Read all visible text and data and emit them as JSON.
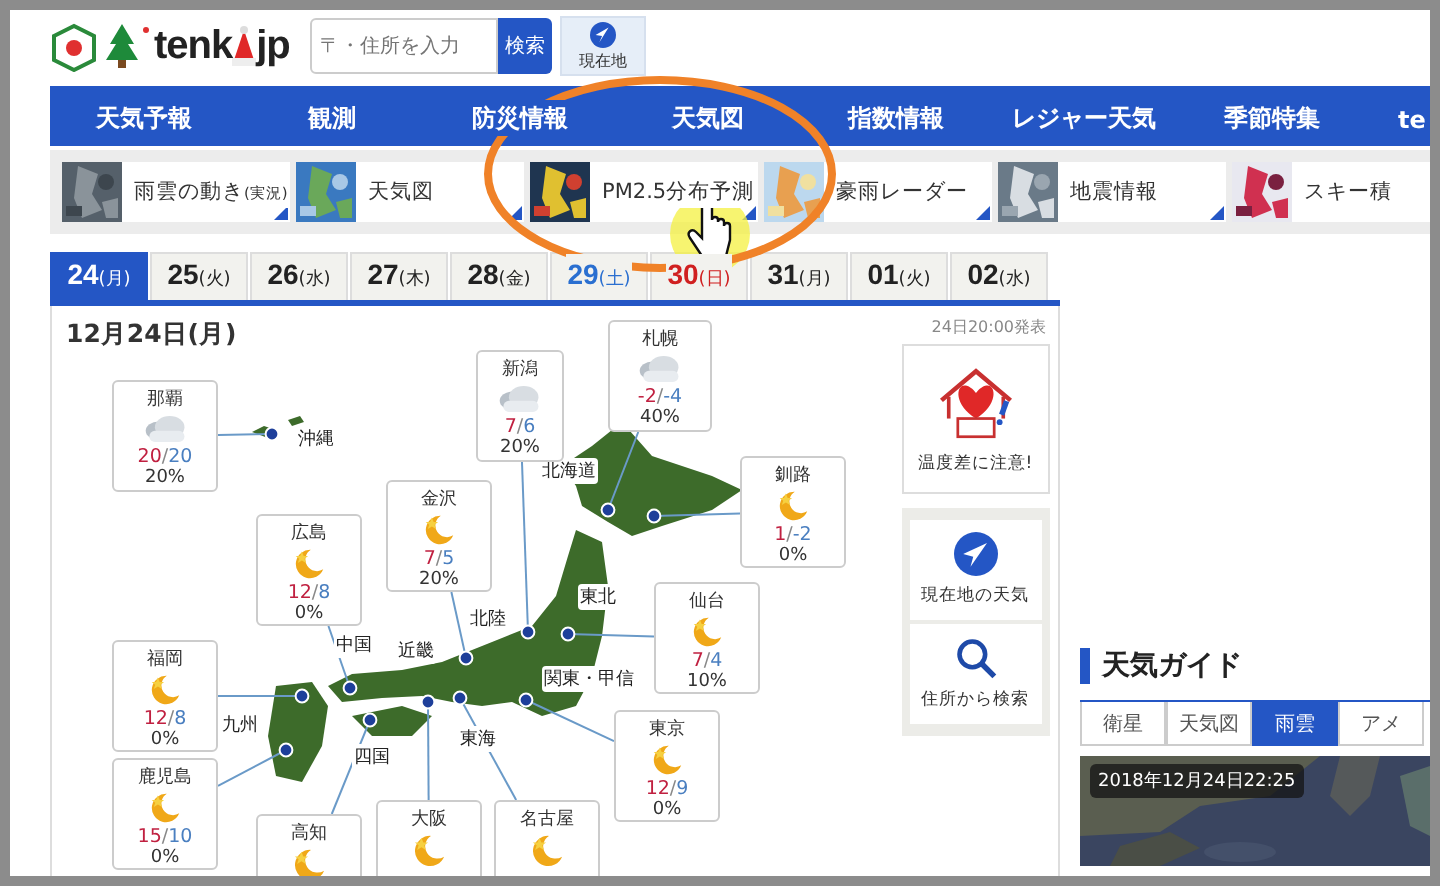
{
  "header": {
    "logo_left": "tenk",
    "logo_right": "jp",
    "search": {
      "placeholder": "〒・住所を入力"
    },
    "search_button": "検索",
    "location_button": "現在地"
  },
  "nav": [
    "天気予報",
    "観測",
    "防災情報",
    "天気図",
    "指数情報",
    "レジャー天気",
    "季節特集",
    "te"
  ],
  "shortcuts": [
    {
      "label": "雨雲の動き",
      "note": "(実況)"
    },
    {
      "label": "天気図"
    },
    {
      "label": "PM2.5分布予測"
    },
    {
      "label": "豪雨レーダー"
    },
    {
      "label": "地震情報"
    },
    {
      "label": "スキー積"
    }
  ],
  "date_tabs": [
    {
      "day": "24",
      "weekday": "(月)",
      "selected": true,
      "kind": "weekday"
    },
    {
      "day": "25",
      "weekday": "(火)",
      "selected": false,
      "kind": "weekday"
    },
    {
      "day": "26",
      "weekday": "(水)",
      "selected": false,
      "kind": "weekday"
    },
    {
      "day": "27",
      "weekday": "(木)",
      "selected": false,
      "kind": "weekday"
    },
    {
      "day": "28",
      "weekday": "(金)",
      "selected": false,
      "kind": "weekday"
    },
    {
      "day": "29",
      "weekday": "(土)",
      "selected": false,
      "kind": "saturday"
    },
    {
      "day": "30",
      "weekday": "(日)",
      "selected": false,
      "kind": "sunday"
    },
    {
      "day": "31",
      "weekday": "(月)",
      "selected": false,
      "kind": "weekday"
    },
    {
      "day": "01",
      "weekday": "(火)",
      "selected": false,
      "kind": "weekday"
    },
    {
      "day": "02",
      "weekday": "(水)",
      "selected": false,
      "kind": "weekday"
    }
  ],
  "forecast": {
    "date": "12月24日(月)",
    "issued": "24日20:00発表",
    "cities": [
      {
        "name": "那覇",
        "kind": "cloudy",
        "temp": "20/20",
        "pop": "20%"
      },
      {
        "name": "新潟",
        "kind": "cloudy",
        "temp": "7/6",
        "pop": "20%"
      },
      {
        "name": "札幌",
        "kind": "cloudy",
        "temp": "-2/-4",
        "pop": "40%"
      },
      {
        "name": "金沢",
        "kind": "moon",
        "temp": "7/5",
        "pop": "20%"
      },
      {
        "name": "広島",
        "kind": "moon",
        "temp": "12/8",
        "pop": "0%"
      },
      {
        "name": "釧路",
        "kind": "moon",
        "temp": "1/-2",
        "pop": "0%"
      },
      {
        "name": "仙台",
        "kind": "moon",
        "temp": "7/4",
        "pop": "10%"
      },
      {
        "name": "福岡",
        "kind": "moon",
        "temp": "12/8",
        "pop": "0%"
      },
      {
        "name": "東京",
        "kind": "moon",
        "temp": "12/9",
        "pop": "0%"
      },
      {
        "name": "鹿児島",
        "kind": "moon",
        "temp": "15/10",
        "pop": "0%"
      },
      {
        "name": "高知",
        "kind": "moon"
      },
      {
        "name": "大阪",
        "kind": "moon"
      },
      {
        "name": "名古屋",
        "kind": "moon"
      }
    ],
    "regions": [
      "沖縄",
      "北海道",
      "東北",
      "北陸",
      "関東・甲信",
      "中国",
      "近畿",
      "九州",
      "四国",
      "東海"
    ],
    "alert": "温度差に注意!",
    "actions": [
      {
        "kind": "location",
        "label": "現在地の天気"
      },
      {
        "kind": "search",
        "label": "住所から検索"
      }
    ]
  },
  "guide": {
    "title": "天気ガイド",
    "tabs": [
      {
        "label": "衛星",
        "selected": false
      },
      {
        "label": "天気図",
        "selected": false
      },
      {
        "label": "雨雲",
        "selected": true
      },
      {
        "label": "アメ",
        "selected": false
      }
    ],
    "timestamp": "2018年12月24日22:25"
  }
}
